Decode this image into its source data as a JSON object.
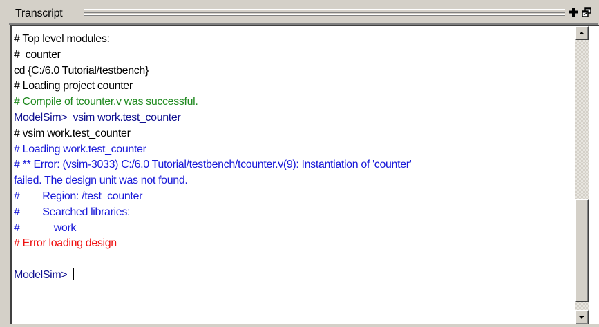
{
  "window": {
    "title": "Transcript",
    "add_icon": "plus-icon",
    "undock_icon": "undock-icon"
  },
  "transcript": {
    "lines": [
      {
        "text": "# Top level modules:",
        "color": "black"
      },
      {
        "text": "#  counter",
        "color": "black"
      },
      {
        "text": "cd {C:/6.0 Tutorial/testbench}",
        "color": "black"
      },
      {
        "text": "# Loading project counter",
        "color": "black"
      },
      {
        "text": "# Compile of tcounter.v was successful.",
        "color": "green"
      },
      {
        "text": "ModelSim>  vsim work.test_counter",
        "color": "prompt"
      },
      {
        "text": "# vsim work.test_counter",
        "color": "black"
      },
      {
        "text": "# Loading work.test_counter",
        "color": "blue"
      },
      {
        "text": "# ** Error: (vsim-3033) C:/6.0 Tutorial/testbench/tcounter.v(9): Instantiation of 'counter'",
        "color": "blue"
      },
      {
        "text": "failed. The design unit was not found.",
        "color": "blue"
      },
      {
        "text": "#        Region: /test_counter",
        "color": "blue"
      },
      {
        "text": "#        Searched libraries:",
        "color": "blue"
      },
      {
        "text": "#            work",
        "color": "blue"
      },
      {
        "text": "# Error loading design",
        "color": "red"
      },
      {
        "text": "",
        "color": "black"
      },
      {
        "text": "ModelSim> ",
        "color": "prompt"
      }
    ],
    "colors": {
      "black": "#000000",
      "green": "#208a20",
      "blue": "#1818d8",
      "red": "#ee1111",
      "prompt": "#101090"
    }
  },
  "scrollbar": {
    "up_icon": "arrow-up-icon",
    "down_icon": "arrow-down-icon",
    "position": 0.95
  }
}
